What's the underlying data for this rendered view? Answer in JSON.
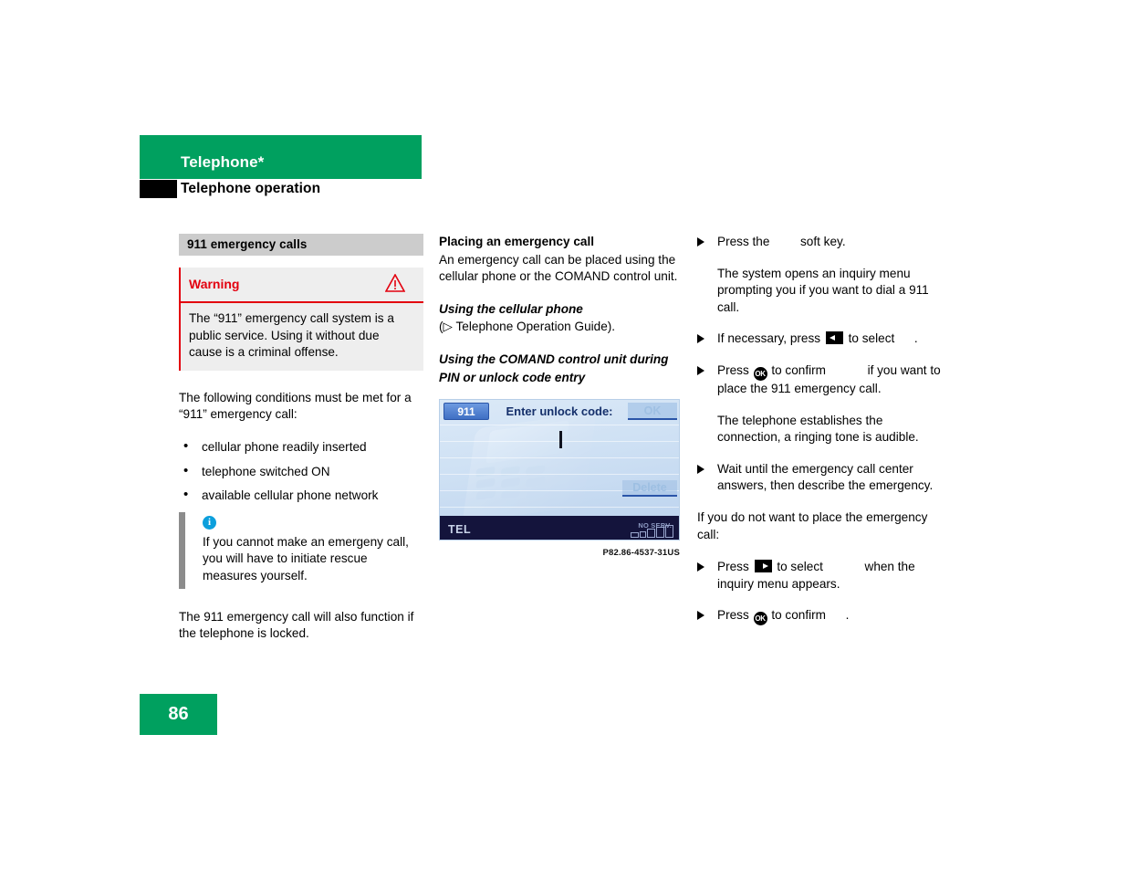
{
  "header": {
    "chapter": "Telephone*",
    "section": "Telephone operation"
  },
  "left_column": {
    "section_heading": "911 emergency calls",
    "warning": {
      "label": "Warning",
      "icon": "warning-triangle-icon",
      "body": "The “911” emergency call system is a public service. Using it without due cause is a criminal offense."
    },
    "intro": "The following conditions must be met for a “911” emergency call:",
    "bullets": [
      "cellular phone readily inserted",
      "telephone switched ON",
      "available cellular phone network"
    ],
    "note": {
      "icon": "info-icon",
      "text": "If you cannot make an emergeny call, you will have to initiate rescue measures yourself."
    },
    "closing": "The 911 emergency call will also function if the telephone is locked."
  },
  "middle_column": {
    "heading": "Placing an emergency call",
    "paragraph": "An emergency call can be placed using the cellular phone or the COMAND control unit.",
    "subheading_1": "Using the cellular phone",
    "subheading_1_text": "(▷ Telephone Operation Guide).",
    "subheading_2_line1": "Using the COMAND control unit during",
    "subheading_2_line2": "PIN or unlock code entry",
    "comand_screen": {
      "emergency_button": "911",
      "title": "Enter unlock code:",
      "ok_button": "OK",
      "delete_button": "Delete",
      "mode_label": "TEL",
      "service_status": "NO SERV."
    },
    "figure_caption": "P82.86-4537-31US"
  },
  "right_column": {
    "steps": [
      {
        "text_before": "Press the",
        "glyph": "inline-911-softkey",
        "text_after": "soft key."
      },
      {
        "continuation": "The system opens an inquiry menu prompting you if you want to dial a 911 call."
      },
      {
        "text_before": "If necessary, press",
        "glyph": "left-arrow-key",
        "text_mid": "to select",
        "glyph_2": "inline-yes-label",
        "text_after": "."
      },
      {
        "text_before": "Press",
        "glyph": "ok-button",
        "text_mid": "to confirm",
        "glyph_2": "inline-yes-label",
        "text_after": "if you want to place the 911 emergency call."
      },
      {
        "continuation": "The telephone establishes the connection, a ringing tone is audible."
      },
      {
        "text": "Wait until the emergency call center answers, then describe the emergency."
      }
    ],
    "cancel_intro": "If you do not want to place the emergency call:",
    "cancel_steps": [
      {
        "text_before": "Press",
        "glyph": "right-arrow-key",
        "text_mid": "to select",
        "glyph_2": "inline-no-label",
        "text_after": "when the inquiry menu appears."
      },
      {
        "text_before": "Press",
        "glyph": "ok-button",
        "text_mid": "to confirm",
        "text_after": "."
      }
    ]
  },
  "footer": {
    "page_number": "86"
  },
  "colors": {
    "brand_green": "#00a05f",
    "warning_red": "#e3000f",
    "info_blue": "#0c9fdc",
    "heading_grey": "#cccccc",
    "comand_navy": "#14143c",
    "comand_button_blue": "#3f6fc4"
  }
}
